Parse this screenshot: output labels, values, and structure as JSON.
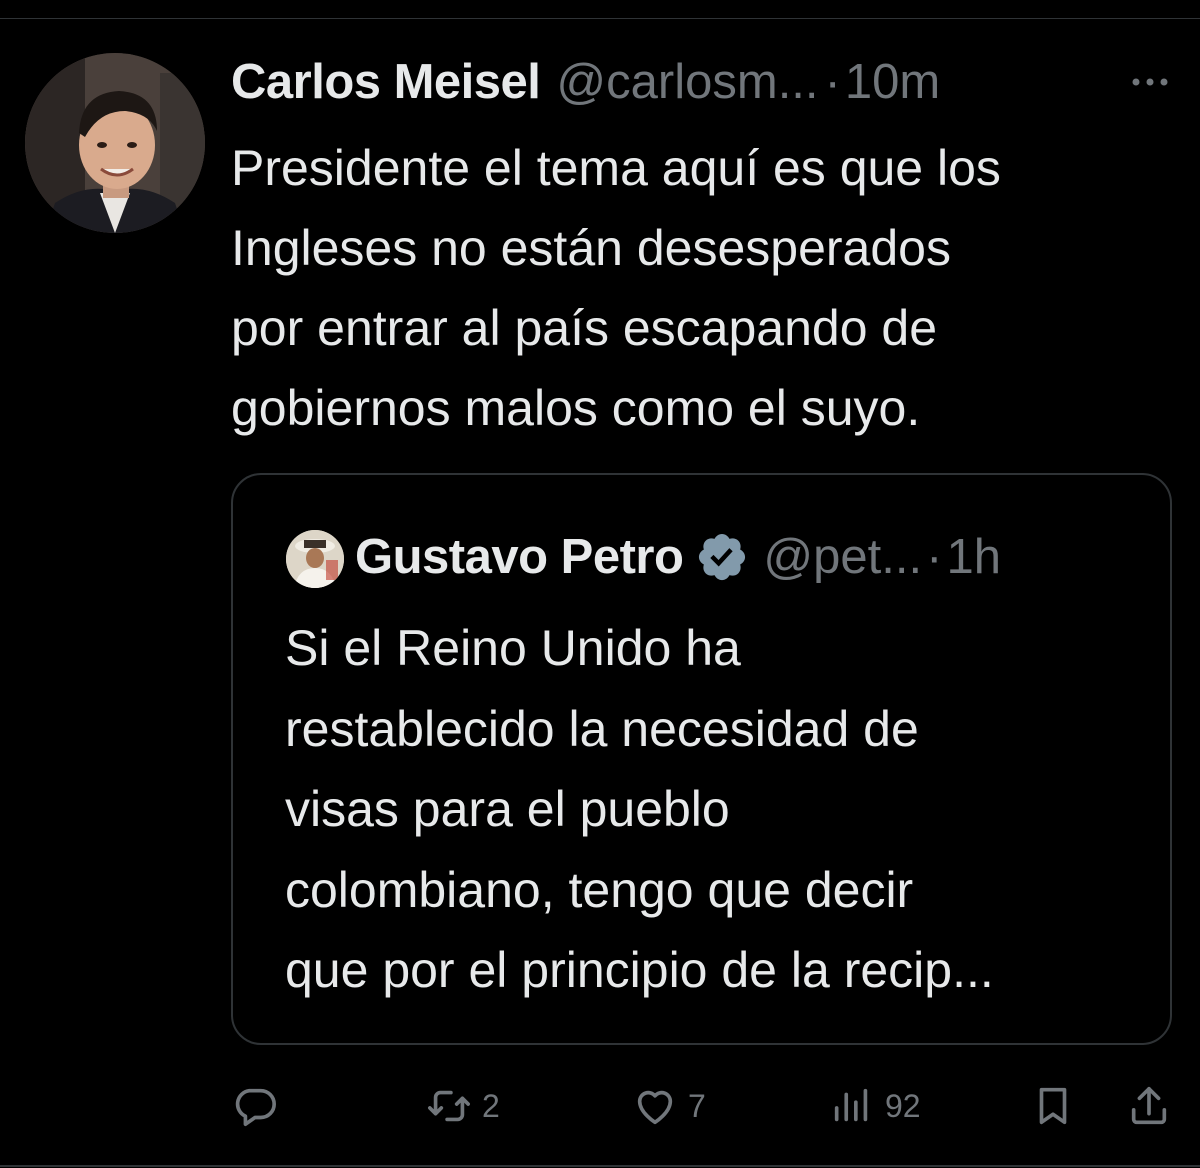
{
  "tweet": {
    "author_name": "Carlos Meisel",
    "author_handle": "@carlosm...",
    "separator": "·",
    "time": "10m",
    "text": "Presidente el tema aquí es que los\nIngleses no están desesperados\npor entrar al país escapando de\ngobiernos malos como el suyo."
  },
  "quoted_tweet": {
    "author_name": "Gustavo Petro",
    "author_handle": "@pet...",
    "separator": "·",
    "time": "1h",
    "verified": true,
    "text": "Si el Reino Unido ha\nrestablecido la necesidad de\nvisas para el pueblo\ncolombiano, tengo que decir\nque por el principio de la recip..."
  },
  "actions": {
    "reply": {
      "icon": "reply-icon",
      "count": ""
    },
    "retweet": {
      "icon": "retweet-icon",
      "count": "2"
    },
    "like": {
      "icon": "heart-icon",
      "count": "7"
    },
    "views": {
      "icon": "views-icon",
      "count": "92"
    },
    "bookmark": {
      "icon": "bookmark-icon"
    },
    "share": {
      "icon": "share-icon"
    }
  },
  "colors": {
    "background": "#000000",
    "text": "#e7e9ea",
    "secondary_text": "#71767b",
    "border": "#2f3336",
    "verified_badge": "#829aab"
  }
}
